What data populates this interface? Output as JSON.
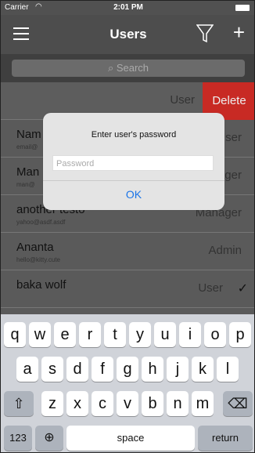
{
  "status": {
    "carrier": "Carrier",
    "time": "2:01 PM"
  },
  "nav": {
    "title": "Users"
  },
  "search": {
    "placeholder": "Search"
  },
  "rows": [
    {
      "role": "User",
      "action": "Delete"
    },
    {
      "name": "Nam",
      "email": "email@",
      "role": "User"
    },
    {
      "name": "Man",
      "email": "man@",
      "role": "ager"
    },
    {
      "name": "another testo",
      "email": "yahoo@asdf.asdf",
      "role": "Manager"
    },
    {
      "name": "Ananta",
      "email": "hello@kitty.cute",
      "role": "Admin"
    },
    {
      "name": "baka wolf",
      "role": "User",
      "selected": true
    }
  ],
  "dialog": {
    "message": "Enter user's password",
    "placeholder": "Password",
    "ok": "OK"
  },
  "keyboard": {
    "row1": [
      "q",
      "w",
      "e",
      "r",
      "t",
      "y",
      "u",
      "i",
      "o",
      "p"
    ],
    "row2": [
      "a",
      "s",
      "d",
      "f",
      "g",
      "h",
      "j",
      "k",
      "l"
    ],
    "row3": [
      "z",
      "x",
      "c",
      "v",
      "b",
      "n",
      "m"
    ],
    "numbers": "123",
    "space": "space",
    "return": "return"
  },
  "colors": {
    "delete": "#c82a24",
    "ok": "#1a74e8",
    "nav": "#4d4d4d"
  }
}
